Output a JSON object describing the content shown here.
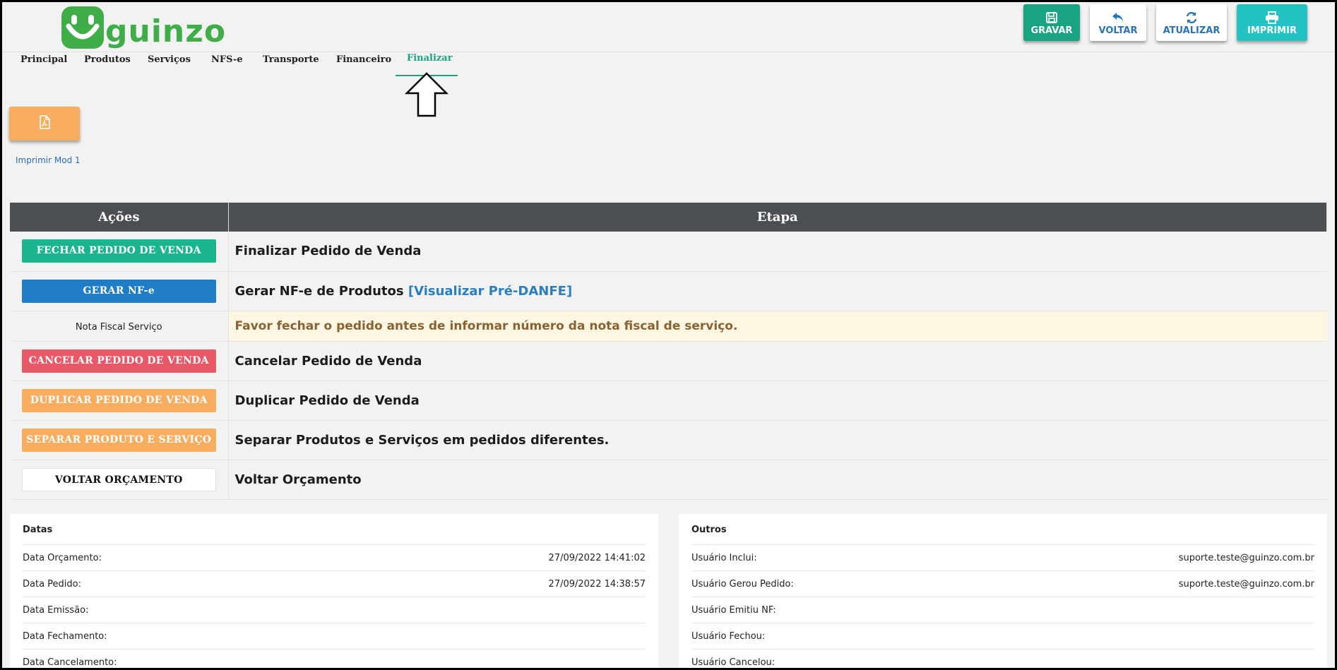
{
  "app": {
    "logo_text": "guinzo"
  },
  "toolbar": {
    "gravar": "GRAVAR",
    "voltar": "VOLTAR",
    "atualizar": "ATUALIZAR",
    "imprimir": "IMPRIMIR"
  },
  "menu": {
    "items": [
      "Principal",
      "Produtos",
      "Serviços",
      "NFS-e",
      "Transporte",
      "Financeiro",
      "Finalizar"
    ],
    "active": "Finalizar"
  },
  "print_mod": {
    "label": "Imprimir Mod 1"
  },
  "actions_table": {
    "headers": {
      "acoes": "Ações",
      "etapa": "Etapa"
    },
    "rows": [
      {
        "button": "FECHAR PEDIDO DE VENDA",
        "etapa": "Finalizar Pedido de Venda"
      },
      {
        "button": "GERAR NF-e",
        "etapa": "Gerar NF-e de Produtos",
        "link": "[Visualizar Pré-DANFE]"
      },
      {
        "label": "Nota Fiscal Serviço",
        "etapa": "Favor fechar o pedido antes de informar número da nota fiscal de serviço."
      },
      {
        "button": "CANCELAR PEDIDO DE VENDA",
        "etapa": "Cancelar Pedido de Venda"
      },
      {
        "button": "DUPLICAR PEDIDO DE VENDA",
        "etapa": "Duplicar Pedido de Venda"
      },
      {
        "button": "SEPARAR PRODUTO E SERVIÇO",
        "etapa": "Separar Produtos e Serviços em pedidos diferentes."
      },
      {
        "button": "VOLTAR ORÇAMENTO",
        "etapa": "Voltar Orçamento"
      }
    ]
  },
  "datas": {
    "title": "Datas",
    "rows": [
      {
        "label": "Data Orçamento:",
        "value": "27/09/2022 14:41:02"
      },
      {
        "label": "Data Pedido:",
        "value": "27/09/2022 14:38:57"
      },
      {
        "label": "Data Emissão:",
        "value": ""
      },
      {
        "label": "Data Fechamento:",
        "value": ""
      },
      {
        "label": "Data Cancelamento:",
        "value": ""
      }
    ]
  },
  "outros": {
    "title": "Outros",
    "rows": [
      {
        "label": "Usuário Inclui:",
        "value": "suporte.teste@guinzo.com.br"
      },
      {
        "label": "Usuário Gerou Pedido:",
        "value": "suporte.teste@guinzo.com.br"
      },
      {
        "label": "Usuário Emitiu NF:",
        "value": ""
      },
      {
        "label": "Usuário Fechou:",
        "value": ""
      },
      {
        "label": "Usuário Cancelou:",
        "value": ""
      }
    ]
  },
  "colors": {
    "brand_green": "#3fae49",
    "accent_teal": "#1aa382",
    "header_dark": "#4b4f52",
    "warn_bg": "#fcf6e2"
  }
}
